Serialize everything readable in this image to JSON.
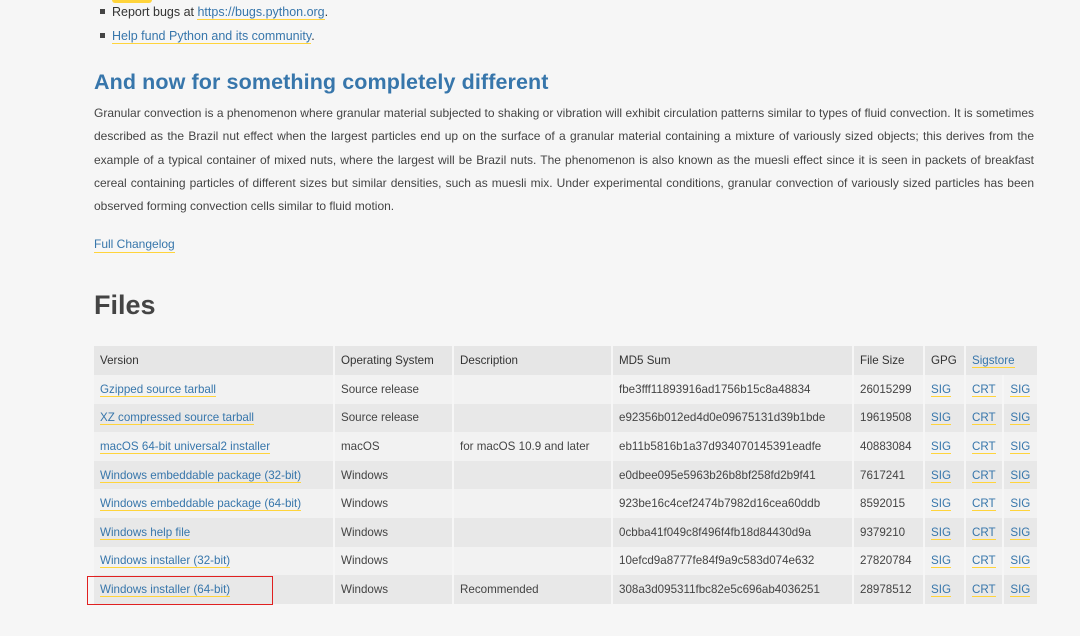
{
  "bullets": [
    {
      "prefix": "Report bugs at ",
      "link": "https://bugs.python.org",
      "suffix": "."
    },
    {
      "prefix": "",
      "link": "Help fund Python and its community",
      "suffix": "."
    }
  ],
  "section": {
    "title": "And now for something completely different",
    "paragraph": "Granular convection is a phenomenon where granular material subjected to shaking or vibration will exhibit circulation patterns similar to types of fluid convection. It is sometimes described as the Brazil nut effect when the largest particles end up on the surface of a granular material containing a mixture of variously sized objects; this derives from the example of a typical container of mixed nuts, where the largest will be Brazil nuts. The phenomenon is also known as the muesli effect since it is seen in packets of breakfast cereal containing particles of different sizes but similar densities, such as muesli mix. Under experimental conditions, granular convection of variously sized particles has been observed forming convection cells similar to fluid motion.",
    "changelog": "Full Changelog"
  },
  "files": {
    "title": "Files",
    "headers": {
      "version": "Version",
      "os": "Operating System",
      "description": "Description",
      "md5": "MD5 Sum",
      "size": "File Size",
      "gpg": "GPG",
      "sigstore": "Sigstore"
    },
    "rows": [
      {
        "version": "Gzipped source tarball",
        "os": "Source release",
        "description": "",
        "md5": "fbe3fff11893916ad1756b15c8a48834",
        "size": "26015299",
        "gpg": "SIG",
        "crt": "CRT",
        "sig": "SIG"
      },
      {
        "version": "XZ compressed source tarball",
        "os": "Source release",
        "description": "",
        "md5": "e92356b012ed4d0e09675131d39b1bde",
        "size": "19619508",
        "gpg": "SIG",
        "crt": "CRT",
        "sig": "SIG"
      },
      {
        "version": "macOS 64-bit universal2 installer",
        "os": "macOS",
        "description": "for macOS 10.9 and later",
        "md5": "eb11b5816b1a37d934070145391eadfe",
        "size": "40883084",
        "gpg": "SIG",
        "crt": "CRT",
        "sig": "SIG"
      },
      {
        "version": "Windows embeddable package (32-bit)",
        "os": "Windows",
        "description": "",
        "md5": "e0dbee095e5963b26b8bf258fd2b9f41",
        "size": "7617241",
        "gpg": "SIG",
        "crt": "CRT",
        "sig": "SIG"
      },
      {
        "version": "Windows embeddable package (64-bit)",
        "os": "Windows",
        "description": "",
        "md5": "923be16c4cef2474b7982d16cea60ddb",
        "size": "8592015",
        "gpg": "SIG",
        "crt": "CRT",
        "sig": "SIG"
      },
      {
        "version": "Windows help file",
        "os": "Windows",
        "description": "",
        "md5": "0cbba41f049c8f496f4fb18d84430d9a",
        "size": "9379210",
        "gpg": "SIG",
        "crt": "CRT",
        "sig": "SIG"
      },
      {
        "version": "Windows installer (32-bit)",
        "os": "Windows",
        "description": "",
        "md5": "10efcd9a8777fe84f9a9c583d074e632",
        "size": "27820784",
        "gpg": "SIG",
        "crt": "CRT",
        "sig": "SIG"
      },
      {
        "version": "Windows installer (64-bit)",
        "os": "Windows",
        "description": "Recommended",
        "md5": "308a3d095311fbc82e5c696ab4036251",
        "size": "28978512",
        "gpg": "SIG",
        "crt": "CRT",
        "sig": "SIG"
      }
    ]
  },
  "colors": {
    "link": "#3776ab",
    "link_underline": "#ffd43b",
    "highlight_box": "#e02020"
  }
}
